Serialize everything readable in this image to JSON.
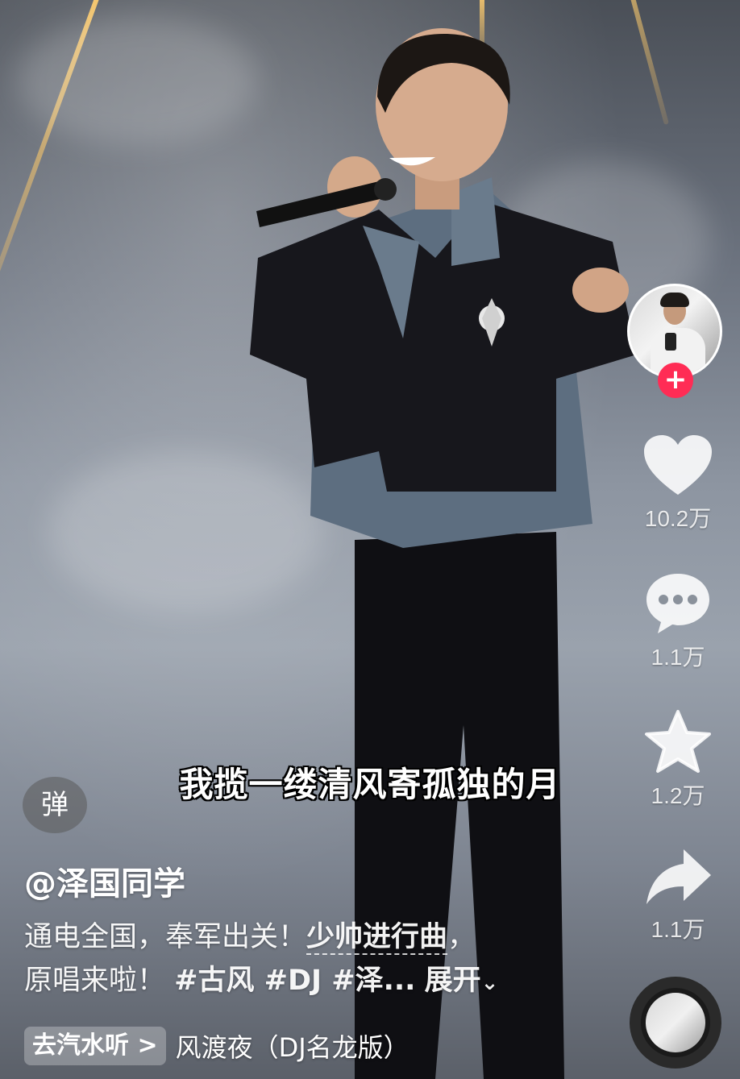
{
  "video": {
    "subtitle": "我揽一缕清风寄孤独的月"
  },
  "side_actions": {
    "follow_symbol": "+",
    "likes": "10.2万",
    "comments": "1.1万",
    "favorites": "1.2万",
    "shares": "1.1万"
  },
  "danmaku_button": "弹",
  "author": {
    "username": "@泽国同学"
  },
  "description": {
    "line1_prefix": "通电全国，奉军出关！",
    "song_link": "少帅进行曲",
    "line1_suffix": "，",
    "line2_prefix": "原唱来啦！",
    "tags": "#古风 #DJ #泽...",
    "expand": "展开"
  },
  "music": {
    "app_button": "去汽水听 >",
    "track": "风渡夜（DJ名龙版）"
  },
  "colors": {
    "follow_button": "#ff2c55",
    "text": "#ffffff"
  },
  "icons": [
    "heart-icon",
    "comment-icon",
    "star-icon",
    "share-icon",
    "plus-icon",
    "chevron-down-icon",
    "music-disc-icon"
  ]
}
